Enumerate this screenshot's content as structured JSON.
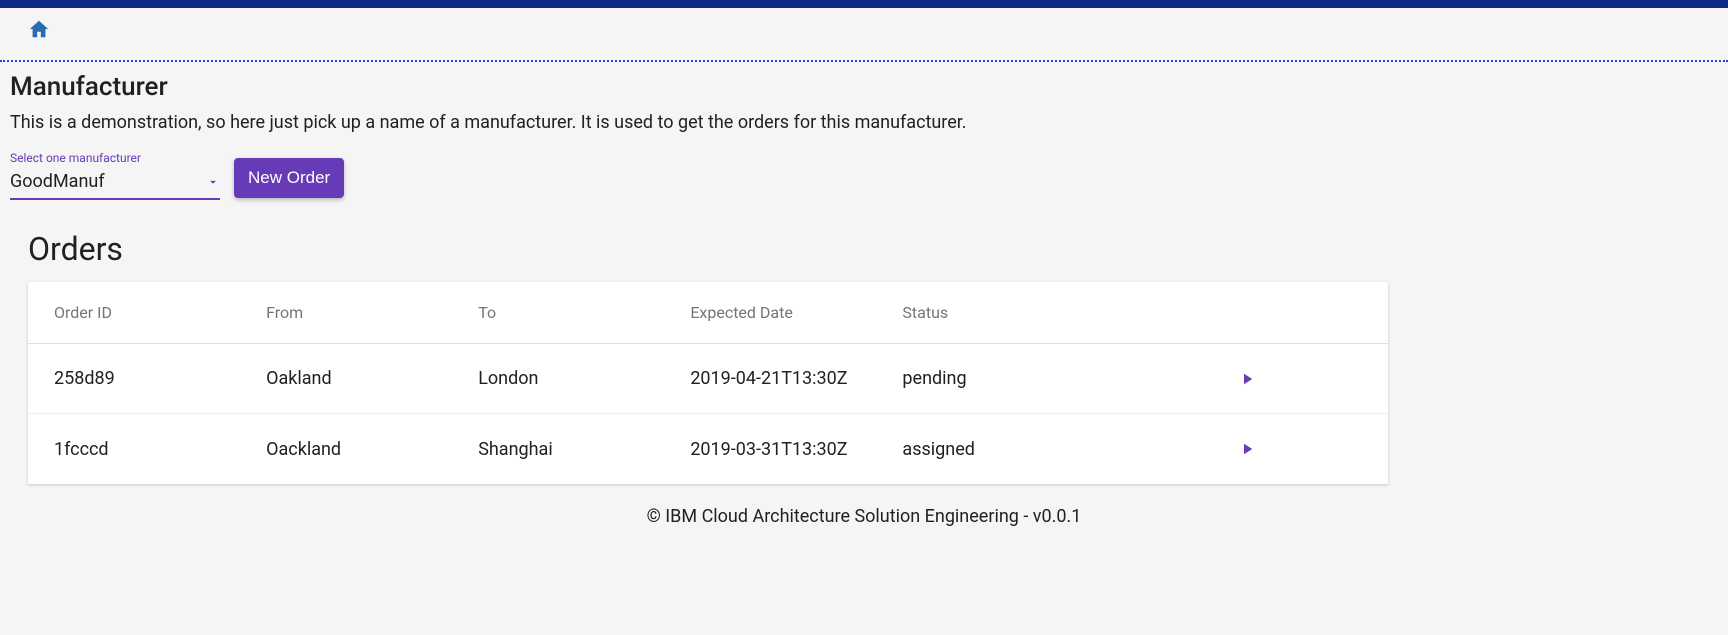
{
  "page": {
    "title": "Manufacturer",
    "description": "This is a demonstration, so here just pick up a name of a manufacturer. It is used to get the orders for this manufacturer."
  },
  "select": {
    "label": "Select one manufacturer",
    "value": "GoodManuf"
  },
  "buttons": {
    "new_order": "New Order"
  },
  "orders": {
    "title": "Orders",
    "columns": {
      "order_id": "Order ID",
      "from": "From",
      "to": "To",
      "expected_date": "Expected Date",
      "status": "Status"
    },
    "rows": [
      {
        "order_id": "258d89",
        "from": "Oakland",
        "to": "London",
        "expected_date": "2019-04-21T13:30Z",
        "status": "pending"
      },
      {
        "order_id": "1fcccd",
        "from": "Oackland",
        "to": "Shanghai",
        "expected_date": "2019-03-31T13:30Z",
        "status": "assigned"
      }
    ]
  },
  "footer": {
    "text": "© IBM Cloud Architecture Solution Engineering - v0.0.1"
  }
}
